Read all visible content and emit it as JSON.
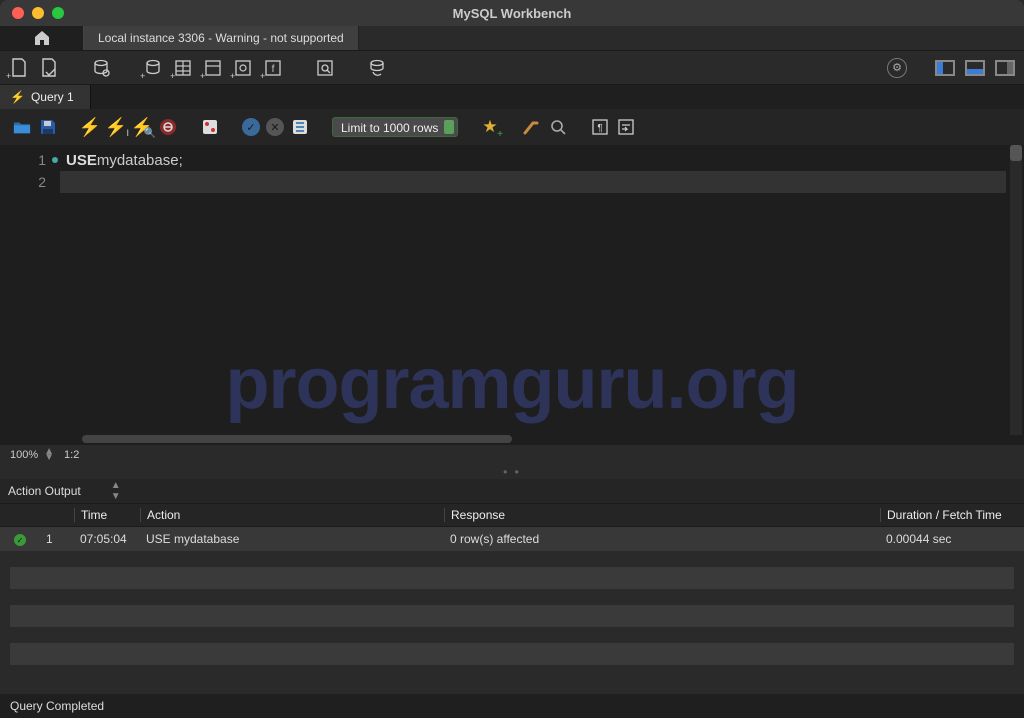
{
  "app": {
    "title": "MySQL Workbench"
  },
  "connection_tab": {
    "label": "Local instance 3306 - Warning - not supported"
  },
  "query_tab": {
    "label": "Query 1"
  },
  "editor_toolbar": {
    "limit_label": "Limit to 1000 rows"
  },
  "code": {
    "lines": [
      {
        "num": "1",
        "keyword": "USE",
        "ident": " mydatabase",
        "semi": ";"
      },
      {
        "num": "2"
      }
    ]
  },
  "watermark": "programguru.org",
  "status": {
    "zoom": "100%",
    "cursor": "1:2"
  },
  "output": {
    "panel_label": "Action Output",
    "columns": {
      "time": "Time",
      "action": "Action",
      "response": "Response",
      "duration": "Duration / Fetch Time"
    },
    "rows": [
      {
        "idx": "1",
        "time": "07:05:04",
        "action": "USE mydatabase",
        "response": "0 row(s) affected",
        "duration": "0.00044 sec"
      }
    ]
  },
  "footer": {
    "status": "Query Completed"
  }
}
